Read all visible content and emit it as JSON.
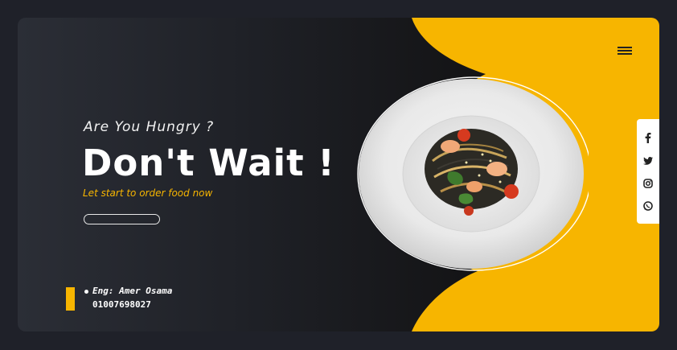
{
  "hero": {
    "eyebrow": "Are You Hungry ?",
    "headline": "Don't Wait !",
    "subline": "Let start to order food now",
    "cta_label": ""
  },
  "footer": {
    "author": "Eng: Amer Osama",
    "phone": "01007698027"
  },
  "social": [
    {
      "name": "facebook-icon"
    },
    {
      "name": "twitter-icon"
    },
    {
      "name": "instagram-icon"
    },
    {
      "name": "whatsapp-icon"
    }
  ],
  "colors": {
    "accent": "#f7b500",
    "dark_bg": "#141416",
    "page_bg": "#1f2129"
  },
  "icons": {
    "menu": "hamburger-menu-icon"
  }
}
